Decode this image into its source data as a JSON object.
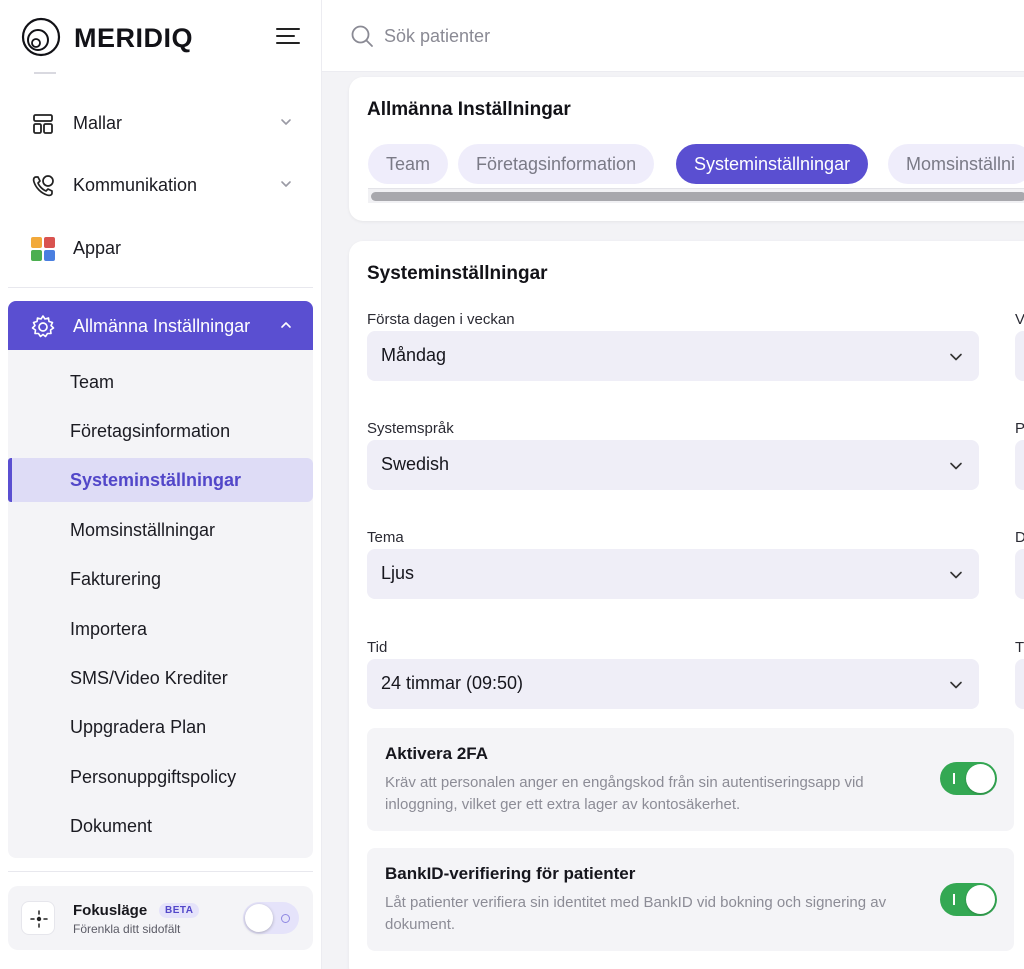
{
  "brand": {
    "name": "MERIDIQ",
    "accent": "#5a4fd1",
    "success": "#34a853"
  },
  "search": {
    "placeholder": "Sök patienter"
  },
  "sidebar": {
    "items": [
      {
        "label": "Mallar",
        "icon": "template-icon"
      },
      {
        "label": "Kommunikation",
        "icon": "phone-chat-icon"
      },
      {
        "label": "Appar",
        "icon": "apps-icon"
      },
      {
        "label": "Allmänna Inställningar",
        "icon": "gear-icon"
      }
    ],
    "subitems": [
      "Team",
      "Företagsinformation",
      "Systeminställningar",
      "Momsinställningar",
      "Fakturering",
      "Importera",
      "SMS/Video Krediter",
      "Uppgradera Plan",
      "Personuppgiftspolicy",
      "Dokument"
    ],
    "focus": {
      "title": "Fokusläge",
      "badge": "BETA",
      "subtitle": "Förenkla ditt sidofält"
    }
  },
  "header_card": {
    "title": "Allmänna Inställningar",
    "tabs": [
      "Team",
      "Företagsinformation",
      "Systeminställningar",
      "Momsinställni"
    ]
  },
  "settings": {
    "title": "Systeminställningar",
    "fields": [
      {
        "label": "Första dagen i veckan",
        "value": "Måndag",
        "right_label": "V"
      },
      {
        "label": "Systemspråk",
        "value": "Swedish",
        "right_label": "P"
      },
      {
        "label": "Tema",
        "value": "Ljus",
        "right_label": "D"
      },
      {
        "label": "Tid",
        "value": "24 timmar (09:50)",
        "right_label": "T"
      }
    ],
    "options": [
      {
        "title": "Aktivera 2FA",
        "desc": "Kräv att personalen anger en engångskod från sin autentiseringsapp vid inloggning, vilket ger ett extra lager av kontosäkerhet.",
        "enabled": true
      },
      {
        "title": "BankID-verifiering för patienter",
        "desc": "Låt patienter verifiera sin identitet med BankID vid bokning och signering av dokument.",
        "enabled": true
      }
    ]
  }
}
